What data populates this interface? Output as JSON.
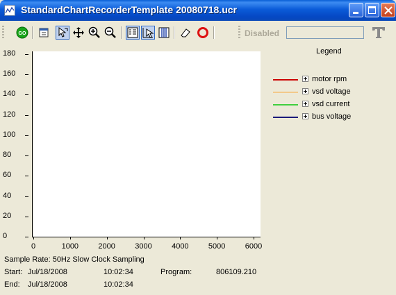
{
  "window": {
    "title": "StandardChartRecorderTemplate 20080718.ucr"
  },
  "toolbar": {
    "status_label": "Disabled",
    "status_value": "",
    "icons": [
      "go-icon",
      "properties-icon",
      "pointer-select-icon",
      "pan-icon",
      "zoom-in-icon",
      "zoom-out-icon",
      "legend-view-icon",
      "cursor-mode-icon",
      "table-view-icon",
      "eraser-icon",
      "record-icon",
      "text-tool-icon"
    ]
  },
  "chart_data": {
    "type": "line",
    "title": "",
    "xlabel": "",
    "ylabel": "",
    "xlim": [
      0,
      6000
    ],
    "ylim": [
      0,
      180
    ],
    "x_ticks": [
      "0",
      "1000",
      "2000",
      "3000",
      "4000",
      "5000",
      "6000"
    ],
    "y_ticks": [
      "180",
      "160",
      "140",
      "120",
      "100",
      "80",
      "60",
      "40",
      "20",
      "0"
    ],
    "grid": false,
    "legend_title": "Legend",
    "legend_position": "right",
    "series": [
      {
        "name": "motor rpm",
        "color": "#cc0000",
        "values": []
      },
      {
        "name": "vsd voltage",
        "color": "#f2c98a",
        "values": []
      },
      {
        "name": "vsd current",
        "color": "#3fcf3f",
        "values": []
      },
      {
        "name": "bus voltage",
        "color": "#1a1a7a",
        "values": []
      }
    ]
  },
  "info": {
    "sample_rate": "Sample Rate:  50Hz Slow Clock Sampling",
    "start_label": "Start:",
    "start_date": "Jul/18/2008",
    "start_time": "10:02:34",
    "program_label": "Program:",
    "program_value": "806109.210",
    "end_label": "End:",
    "end_date": "Jul/18/2008",
    "end_time": "10:02:34"
  }
}
